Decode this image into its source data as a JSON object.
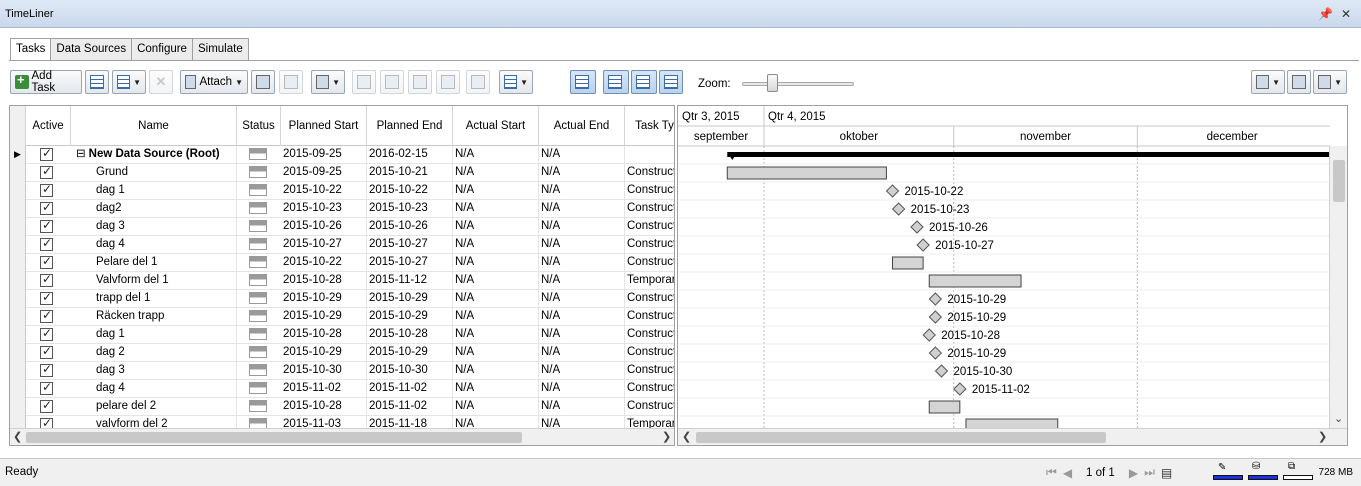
{
  "window": {
    "title": "TimeLiner"
  },
  "tabs": [
    {
      "label": "Tasks",
      "active": true
    },
    {
      "label": "Data Sources",
      "active": false
    },
    {
      "label": "Configure",
      "active": false
    },
    {
      "label": "Simulate",
      "active": false
    }
  ],
  "toolbar": {
    "add_task_label": "Add Task",
    "attach_label": "Attach",
    "zoom_label": "Zoom:",
    "zoom_level": 0.25
  },
  "grid": {
    "columns": [
      "Active",
      "Name",
      "Status",
      "Planned Start",
      "Planned End",
      "Actual Start",
      "Actual End",
      "Task Ty"
    ],
    "root": {
      "expander": "⊟",
      "name": "New Data Source (Root)",
      "planned_start": "2015-09-25",
      "planned_end": "2016-02-15",
      "actual_start": "N/A",
      "actual_end": "N/A",
      "task_type": ""
    },
    "rows": [
      {
        "name": "Grund",
        "planned_start": "2015-09-25",
        "planned_end": "2015-10-21",
        "actual_start": "N/A",
        "actual_end": "N/A",
        "task_type": "Construct"
      },
      {
        "name": "dag 1",
        "planned_start": "2015-10-22",
        "planned_end": "2015-10-22",
        "actual_start": "N/A",
        "actual_end": "N/A",
        "task_type": "Construct"
      },
      {
        "name": "dag2",
        "planned_start": "2015-10-23",
        "planned_end": "2015-10-23",
        "actual_start": "N/A",
        "actual_end": "N/A",
        "task_type": "Construct"
      },
      {
        "name": "dag 3",
        "planned_start": "2015-10-26",
        "planned_end": "2015-10-26",
        "actual_start": "N/A",
        "actual_end": "N/A",
        "task_type": "Construct"
      },
      {
        "name": "dag 4",
        "planned_start": "2015-10-27",
        "planned_end": "2015-10-27",
        "actual_start": "N/A",
        "actual_end": "N/A",
        "task_type": "Construct"
      },
      {
        "name": "Pelare del 1",
        "planned_start": "2015-10-22",
        "planned_end": "2015-10-27",
        "actual_start": "N/A",
        "actual_end": "N/A",
        "task_type": "Construct"
      },
      {
        "name": "Valvform del 1",
        "planned_start": "2015-10-28",
        "planned_end": "2015-11-12",
        "actual_start": "N/A",
        "actual_end": "N/A",
        "task_type": "Temporary"
      },
      {
        "name": "trapp del 1",
        "planned_start": "2015-10-29",
        "planned_end": "2015-10-29",
        "actual_start": "N/A",
        "actual_end": "N/A",
        "task_type": "Construct"
      },
      {
        "name": "Räcken trapp",
        "planned_start": "2015-10-29",
        "planned_end": "2015-10-29",
        "actual_start": "N/A",
        "actual_end": "N/A",
        "task_type": "Construct"
      },
      {
        "name": "dag 1",
        "planned_start": "2015-10-28",
        "planned_end": "2015-10-28",
        "actual_start": "N/A",
        "actual_end": "N/A",
        "task_type": "Construct"
      },
      {
        "name": "dag 2",
        "planned_start": "2015-10-29",
        "planned_end": "2015-10-29",
        "actual_start": "N/A",
        "actual_end": "N/A",
        "task_type": "Construct"
      },
      {
        "name": "dag 3",
        "planned_start": "2015-10-30",
        "planned_end": "2015-10-30",
        "actual_start": "N/A",
        "actual_end": "N/A",
        "task_type": "Construct"
      },
      {
        "name": "dag 4",
        "planned_start": "2015-11-02",
        "planned_end": "2015-11-02",
        "actual_start": "N/A",
        "actual_end": "N/A",
        "task_type": "Construct"
      },
      {
        "name": "pelare del 2",
        "planned_start": "2015-10-28",
        "planned_end": "2015-11-02",
        "actual_start": "N/A",
        "actual_end": "N/A",
        "task_type": "Construct"
      },
      {
        "name": "valvform del 2",
        "planned_start": "2015-11-03",
        "planned_end": "2015-11-18",
        "actual_start": "N/A",
        "actual_end": "N/A",
        "task_type": "Temporary"
      }
    ]
  },
  "gantt": {
    "quarters": [
      "Qtr 3, 2015",
      "Qtr 4, 2015"
    ],
    "months": [
      "september",
      "oktober",
      "november",
      "december"
    ]
  },
  "status_bar": {
    "status": "Ready",
    "page": "1 of 1",
    "memory": "728 MB"
  }
}
